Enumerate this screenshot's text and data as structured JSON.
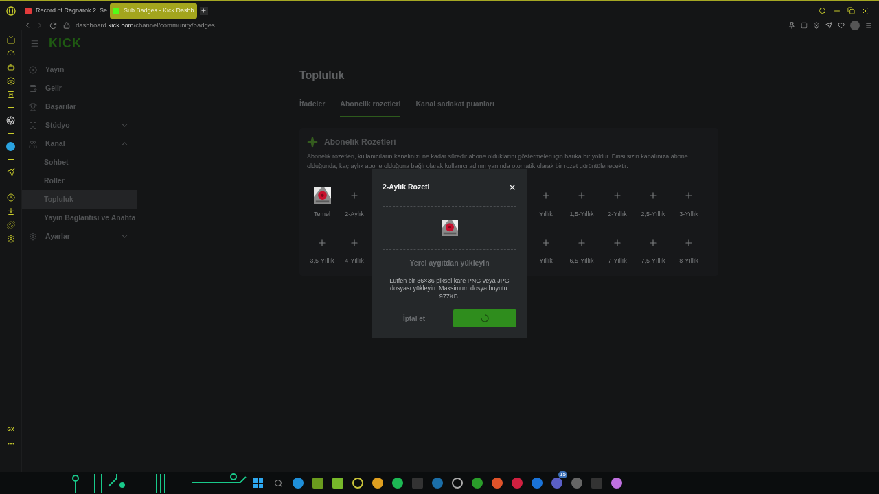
{
  "browser": {
    "tabs": [
      {
        "title": "Record of Ragnarok 2. Se",
        "selected": false
      },
      {
        "title": "Sub Badges - Kick Dashb",
        "selected": true
      }
    ],
    "url": {
      "host": "dashboard.",
      "domain": "kick.com",
      "path": "/channel/community/badges"
    }
  },
  "opera_sidebar": {
    "label": "GX"
  },
  "logo": "KICK",
  "nav": [
    {
      "label": "Yayın",
      "kind": "item",
      "selected": false
    },
    {
      "label": "Gelir",
      "kind": "item",
      "selected": false
    },
    {
      "label": "Başarılar",
      "kind": "item",
      "selected": false
    },
    {
      "label": "Stüdyo",
      "kind": "group",
      "expanded": false,
      "selected": false
    },
    {
      "label": "Kanal",
      "kind": "group",
      "expanded": true,
      "selected": false,
      "children": [
        {
          "label": "Sohbet",
          "selected": false
        },
        {
          "label": "Roller",
          "selected": false
        },
        {
          "label": "Topluluk",
          "selected": true
        },
        {
          "label": "Yayın Bağlantısı ve Anahta",
          "selected": false
        }
      ]
    },
    {
      "label": "Ayarlar",
      "kind": "group",
      "expanded": false,
      "selected": false
    }
  ],
  "page": {
    "title": "Topluluk",
    "tabs": [
      {
        "label": "İfadeler",
        "selected": false
      },
      {
        "label": "Abonelik rozetleri",
        "selected": true
      },
      {
        "label": "Kanal sadakat puanları",
        "selected": false
      }
    ],
    "section": {
      "title": "Abonelik Rozetleri",
      "description": "Abonelik rozetleri, kullanıcıların kanalınızı ne kadar süredir abone olduklarını göstermeleri için harika bir yoldur. Birisi sizin kanalınıza abone olduğunda, kaç aylık abone olduğuna bağlı olarak kullanıcı adının yanında otomatik olarak bir rozet görüntülenecektir.",
      "badge_rows": [
        {
          "left": [
            {
              "label": "Temel"
            },
            {
              "label": "2-Aylık",
              "kind": "add"
            }
          ],
          "right": [
            {
              "label": "Yıllık",
              "kind": "add"
            },
            {
              "label": "1,5-Yıllık",
              "kind": "add"
            },
            {
              "label": "2-Yıllık",
              "kind": "add"
            },
            {
              "label": "2,5-Yıllık",
              "kind": "add"
            },
            {
              "label": "3-Yıllık",
              "kind": "add"
            }
          ]
        },
        {
          "left": [
            {
              "label": "3,5-Yıllık",
              "kind": "add"
            },
            {
              "label": "4-Yıllık",
              "kind": "add"
            }
          ],
          "right": [
            {
              "label": "Yıllık",
              "kind": "add"
            },
            {
              "label": "6,5-Yıllık",
              "kind": "add"
            },
            {
              "label": "7-Yıllık",
              "kind": "add"
            },
            {
              "label": "7,5-Yıllık",
              "kind": "add"
            },
            {
              "label": "8-Yıllık",
              "kind": "add"
            }
          ]
        }
      ]
    }
  },
  "modal": {
    "title": "2-Aylık Rozeti",
    "upload_label": "Yerel aygıtdan yükleyin",
    "help": "Lütfen bir 36×36 piksel kare PNG veya JPG dosyası yükleyin. Maksimum dosya boyutu: 977KB.",
    "cancel": "İptal et",
    "submit_loading": true
  },
  "taskbar": {
    "badge": "15"
  }
}
